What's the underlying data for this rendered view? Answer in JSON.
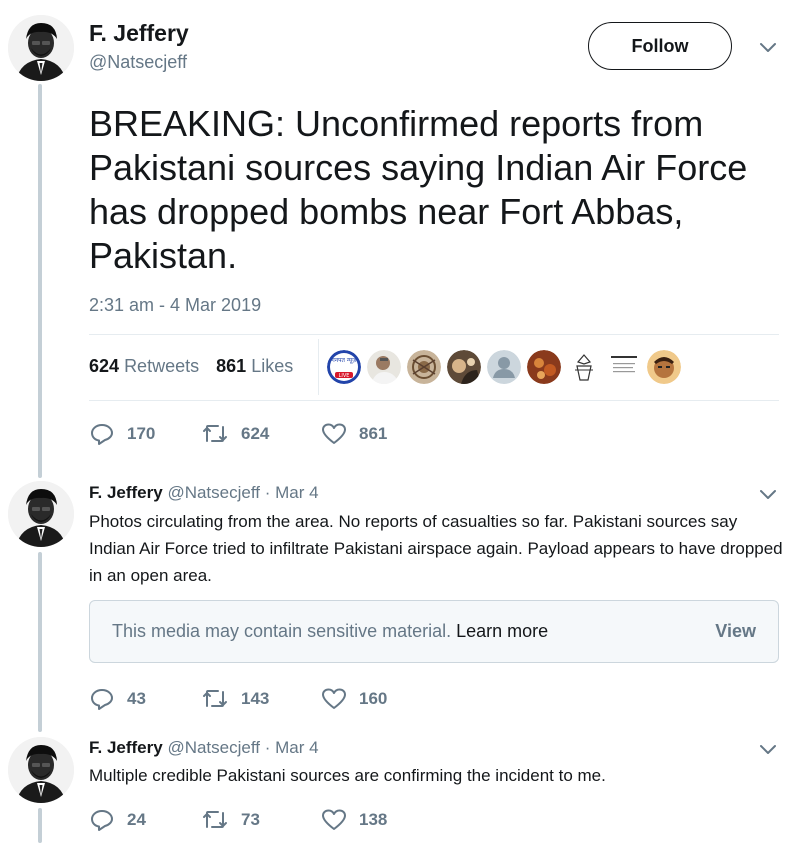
{
  "main_tweet": {
    "name": "F. Jeffery",
    "handle": "@Natsecjeff",
    "follow_label": "Follow",
    "text": "BREAKING: Unconfirmed reports from Pakistani sources saying Indian Air Force has dropped bombs near Fort Abbas, Pakistan.",
    "timestamp": "2:31 am - 4 Mar 2019",
    "retweets_count": "624",
    "retweets_label": "Retweets",
    "likes_count": "861",
    "likes_label": "Likes",
    "likers": [
      "liker-news-live",
      "liker-man",
      "liker-pattern",
      "liker-portrait",
      "liker-default",
      "liker-orange",
      "liker-sketch",
      "liker-text",
      "liker-face"
    ],
    "liker_logo_text": "गनपत न्यूज़",
    "liker_logo_badge": "LIVE",
    "replies": "170",
    "retweets": "624",
    "likes": "861"
  },
  "reply1": {
    "name": "F. Jeffery",
    "handle": "@Natsecjeff",
    "date": "· Mar 4",
    "text": "Photos circulating from the area. No reports of casualties so far. Pakistani sources say Indian Air Force tried to infiltrate Pakistani airspace again. Payload appears to have dropped in an open area.",
    "sensitive_text": "This media may contain sensitive material.",
    "sensitive_link": "Learn more",
    "view_label": "View",
    "replies": "43",
    "retweets": "143",
    "likes": "160"
  },
  "reply2": {
    "name": "F. Jeffery",
    "handle": "@Natsecjeff",
    "date": "· Mar 4",
    "text": "Multiple credible Pakistani sources are confirming the incident to me.",
    "replies": "24",
    "retweets": "73",
    "likes": "138"
  },
  "colors": {
    "text": "#14171a",
    "muted": "#657786",
    "thread_line": "#c4cfd6",
    "divider": "#e6ecf0"
  }
}
